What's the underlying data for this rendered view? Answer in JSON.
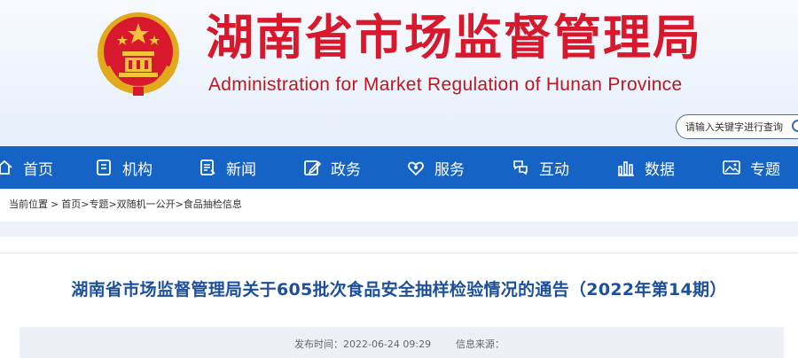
{
  "header": {
    "site_title": "湖南省市场监督管理局",
    "site_subtitle": "Administration for Market Regulation of Hunan Province",
    "search_placeholder": "请输入关键字进行查询",
    "brand_red": "#d8182d",
    "nav_blue": "#1463c5"
  },
  "nav": {
    "items": [
      {
        "label": "首页",
        "icon": "home-icon"
      },
      {
        "label": "机构",
        "icon": "document-icon"
      },
      {
        "label": "新闻",
        "icon": "news-icon"
      },
      {
        "label": "政务",
        "icon": "edit-icon"
      },
      {
        "label": "服务",
        "icon": "service-icon"
      },
      {
        "label": "互动",
        "icon": "interaction-icon"
      },
      {
        "label": "数据",
        "icon": "bar-chart-icon"
      },
      {
        "label": "专题",
        "icon": "image-icon"
      }
    ]
  },
  "breadcrumb": {
    "label": "当前位置",
    "items": [
      "首页",
      "专题",
      "双随机一公开",
      "食品抽检信息"
    ]
  },
  "article": {
    "title": "湖南省市场监督管理局关于605批次食品安全抽样检验情况的通告（2022年第14期）",
    "published_label": "发布时间：2022-06-24 09:29",
    "source_label": "信息来源："
  }
}
